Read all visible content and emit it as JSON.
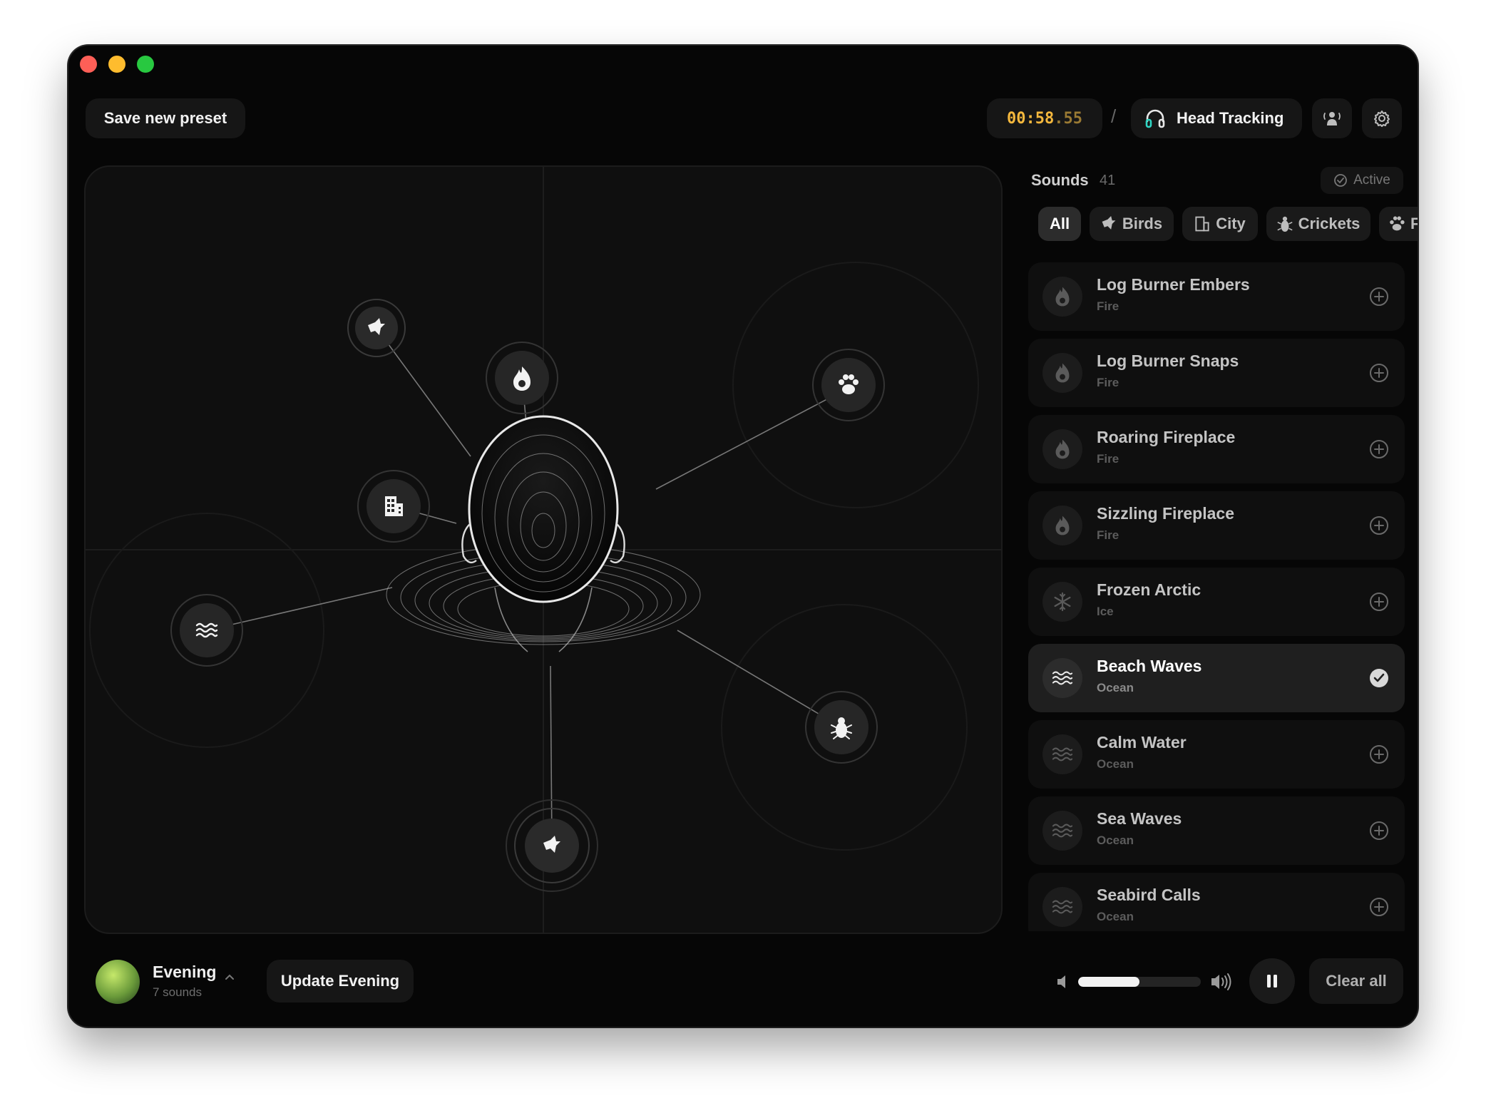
{
  "toolbar": {
    "save_preset_label": "Save new preset",
    "timer_main": "00:58",
    "timer_fraction": ".55",
    "separator": "/",
    "head_tracking_label": "Head Tracking",
    "headphones_icon": "headphones-icon",
    "profile_icon": "person-wave-icon",
    "settings_icon": "gear-icon"
  },
  "stage": {
    "nodes": [
      {
        "id": "bird-top",
        "icon": "bird-icon"
      },
      {
        "id": "fire",
        "icon": "flame-icon"
      },
      {
        "id": "paw",
        "icon": "paw-icon"
      },
      {
        "id": "city",
        "icon": "building-icon"
      },
      {
        "id": "waves",
        "icon": "waves-icon"
      },
      {
        "id": "bug",
        "icon": "bug-icon"
      },
      {
        "id": "bird-bottom",
        "icon": "bird-icon"
      }
    ],
    "listener": "head-icon"
  },
  "sidebar": {
    "title": "Sounds",
    "count": "41",
    "active_label": "Active",
    "filters": [
      {
        "label": "All",
        "icon": "",
        "selected": true
      },
      {
        "label": "Birds",
        "icon": "bird-icon",
        "selected": false
      },
      {
        "label": "City",
        "icon": "building-icon",
        "selected": false
      },
      {
        "label": "Crickets",
        "icon": "bug-icon",
        "selected": false
      },
      {
        "label": "F",
        "icon": "paw-icon",
        "selected": false
      }
    ],
    "sounds": [
      {
        "name": "Log Burner Embers",
        "category": "Fire",
        "icon": "flame-icon",
        "selected": false
      },
      {
        "name": "Log Burner Snaps",
        "category": "Fire",
        "icon": "flame-icon",
        "selected": false
      },
      {
        "name": "Roaring Fireplace",
        "category": "Fire",
        "icon": "flame-icon",
        "selected": false
      },
      {
        "name": "Sizzling Fireplace",
        "category": "Fire",
        "icon": "flame-icon",
        "selected": false
      },
      {
        "name": "Frozen Arctic",
        "category": "Ice",
        "icon": "snowflake-icon",
        "selected": false
      },
      {
        "name": "Beach Waves",
        "category": "Ocean",
        "icon": "waves-icon",
        "selected": true
      },
      {
        "name": "Calm Water",
        "category": "Ocean",
        "icon": "waves-icon",
        "selected": false
      },
      {
        "name": "Sea Waves",
        "category": "Ocean",
        "icon": "waves-icon",
        "selected": false
      },
      {
        "name": "Seabird Calls",
        "category": "Ocean",
        "icon": "waves-icon",
        "selected": false
      }
    ]
  },
  "footer": {
    "preset_name": "Evening",
    "preset_count": "7 sounds",
    "update_label": "Update Evening",
    "volume_fraction": 0.5,
    "clear_label": "Clear all",
    "pause_icon": "pause-icon",
    "vol_low_icon": "speaker-low-icon",
    "vol_high_icon": "speaker-high-icon"
  },
  "colors": {
    "accent": "#f5b83d",
    "window_bg": "#060606",
    "panel_bg": "#0f0f0f"
  }
}
